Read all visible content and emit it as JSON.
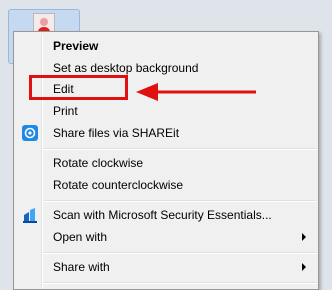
{
  "context_menu": {
    "items": [
      {
        "label": "Preview"
      },
      {
        "label": "Set as desktop background"
      },
      {
        "label": "Edit"
      },
      {
        "label": "Print"
      },
      {
        "label": "Share files via SHAREit"
      },
      {
        "label": "Rotate clockwise"
      },
      {
        "label": "Rotate counterclockwise"
      },
      {
        "label": "Scan with Microsoft Security Essentials..."
      },
      {
        "label": "Open with"
      },
      {
        "label": "Share with"
      }
    ]
  },
  "colors": {
    "annotation_red": "#e01010",
    "shareit_icon": "#1e88e5",
    "mse_icon": "#1565c0"
  },
  "icons": {
    "shareit": "shareit-icon",
    "security_essentials": "microsoft-security-essentials-icon",
    "submenu": "chevron-right-icon"
  }
}
